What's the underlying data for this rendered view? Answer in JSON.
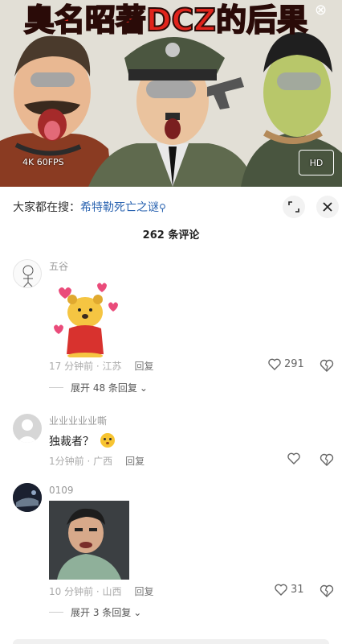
{
  "video": {
    "title": "臭名昭著DCZ的后果",
    "quality_badge": "4K 60FPS",
    "hd_badge": "HD"
  },
  "search": {
    "prefix": "大家都在搜：",
    "term": "希特勒死亡之谜"
  },
  "comments_header": {
    "count_label": "262 条评论"
  },
  "comments": [
    {
      "username": "五谷",
      "text": "",
      "time": "17 分钟前 · 江苏",
      "reply_label": "回复",
      "likes": "291",
      "expand_label": "展开 48 条回复"
    },
    {
      "username": "业业业业业嘶",
      "text": "独裁者？",
      "time": "1分钟前 · 广西",
      "reply_label": "回复",
      "likes": ""
    },
    {
      "username": "0109",
      "text": "",
      "time": "10 分钟前 · 山西",
      "reply_label": "回复",
      "likes": "31",
      "expand_label": "展开 3 条回复"
    }
  ],
  "colors": {
    "link": "#2a63b0",
    "title_red": "#e0241c",
    "meta_gray": "#aaaaaa"
  }
}
